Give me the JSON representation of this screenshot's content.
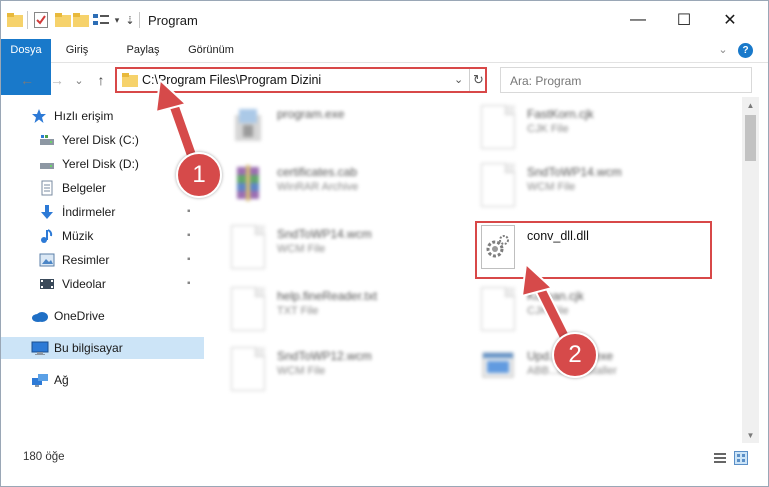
{
  "window": {
    "title": "Program",
    "minimize_glyph": "—",
    "maximize_glyph": "☐",
    "close_glyph": "✕"
  },
  "ribbon": {
    "tabs": [
      "Dosya",
      "Giriş",
      "Paylaş",
      "Görünüm"
    ],
    "expand_glyph": "⌄",
    "help_glyph": "?"
  },
  "nav": {
    "back_glyph": "←",
    "forward_glyph": "→",
    "recent_glyph": "⌄",
    "up_glyph": "↑",
    "address_path": "C:\\Program Files\\Program Dizini",
    "address_dropdown_glyph": "⌄",
    "refresh_glyph": "↻",
    "search_placeholder": "Ara: Program"
  },
  "sidebar": {
    "items": [
      {
        "label": "Hızlı erişim",
        "icon": "star-icon",
        "pinned": false
      },
      {
        "label": "Yerel Disk (C:)",
        "icon": "drive-icon",
        "pinned": true
      },
      {
        "label": "Yerel Disk (D:)",
        "icon": "drive-icon",
        "pinned": true
      },
      {
        "label": "Belgeler",
        "icon": "documents-icon",
        "pinned": true
      },
      {
        "label": "İndirmeler",
        "icon": "downloads-icon",
        "pinned": true
      },
      {
        "label": "Müzik",
        "icon": "music-icon",
        "pinned": true
      },
      {
        "label": "Resimler",
        "icon": "pictures-icon",
        "pinned": true
      },
      {
        "label": "Videolar",
        "icon": "videos-icon",
        "pinned": true
      },
      {
        "label": "OneDrive",
        "icon": "onedrive-icon",
        "pinned": false
      },
      {
        "label": "Bu bilgisayar",
        "icon": "computer-icon",
        "pinned": false
      },
      {
        "label": "Ağ",
        "icon": "network-icon",
        "pinned": false
      }
    ],
    "pin_glyph": "📌"
  },
  "files": [
    {
      "name": "program.exe",
      "type": "",
      "icon": "installer-icon"
    },
    {
      "name": "FastKorn.cjk",
      "type": "CJK File",
      "icon": "file-icon"
    },
    {
      "name": "certificates.cab",
      "type": "WinRAR Archive",
      "icon": "winrar-icon"
    },
    {
      "name": "SndToWP14.wcm",
      "type": "WCM File",
      "icon": "file-icon"
    },
    {
      "name": "SndToWP14.wcm",
      "type": "WCM File",
      "icon": "file-icon"
    },
    {
      "name": "conv_dll.dll",
      "type": "",
      "icon": "dll-gear-icon"
    },
    {
      "name": "help.fineReader.txt",
      "type": "TXT File",
      "icon": "file-icon"
    },
    {
      "name": "Korean.cjk",
      "type": "CJK File",
      "icon": "file-icon"
    },
    {
      "name": "SndToWP12.wcm",
      "type": "WCM File",
      "icon": "file-icon"
    },
    {
      "name": "Upd...staller.exe",
      "type": "ABB...ons installer",
      "icon": "installer-icon"
    }
  ],
  "status": {
    "item_count": "180 öğe"
  },
  "callouts": [
    "1",
    "2"
  ],
  "colors": {
    "accent": "#1979ca",
    "highlight": "#d84848",
    "callout": "#d64a4a"
  }
}
